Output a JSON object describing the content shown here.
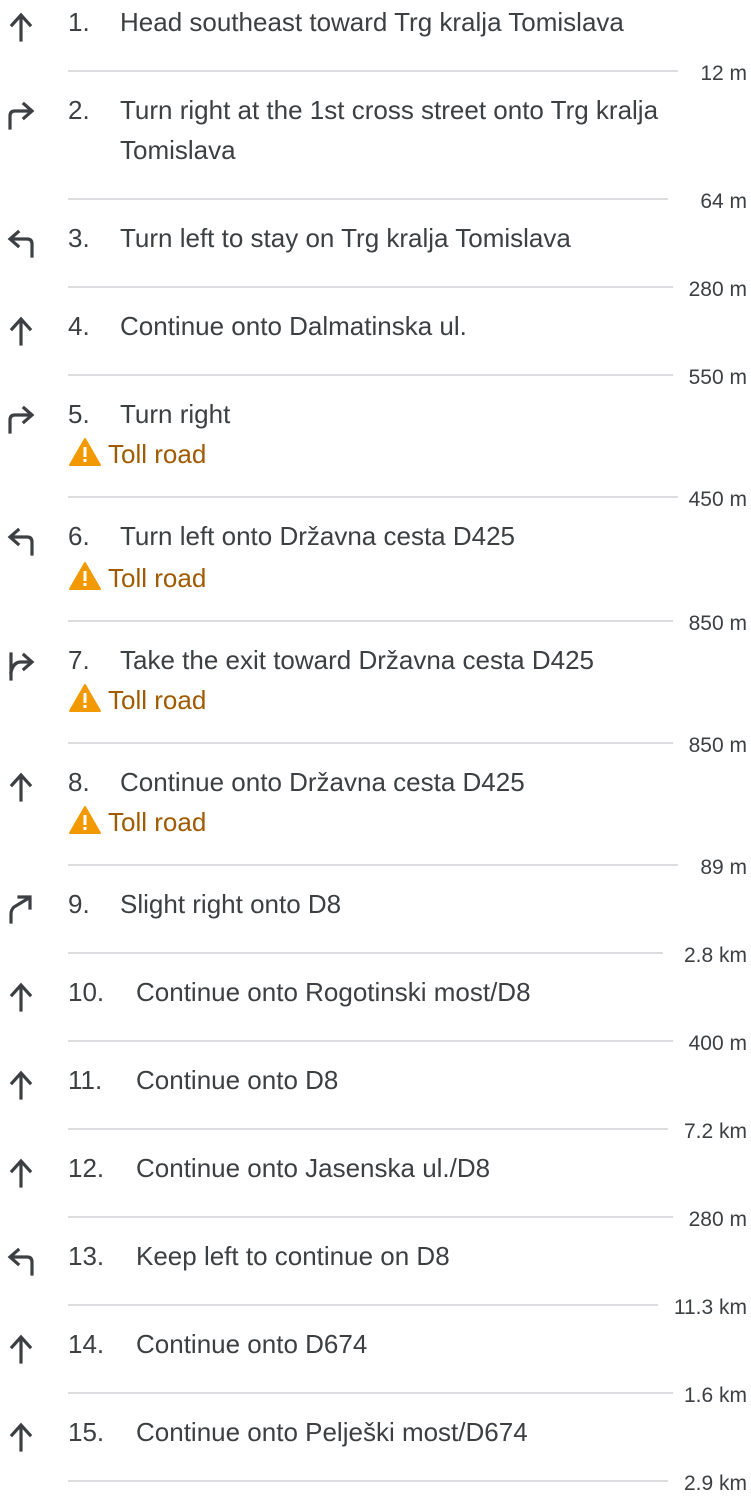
{
  "steps": [
    {
      "number": "1.",
      "text": "Head southeast toward Trg kralja Tomislava",
      "distance": "12 m",
      "maneuver": "straight-arrow-icon"
    },
    {
      "number": "2.",
      "text": "Turn right at the 1st cross street onto Trg kralja Tomislava",
      "distance": "64 m",
      "maneuver": "turn-right-arrow-icon"
    },
    {
      "number": "3.",
      "text": "Turn left to stay on Trg kralja Tomislava",
      "distance": "280 m",
      "maneuver": "turn-left-arrow-icon"
    },
    {
      "number": "4.",
      "text": "Continue onto Dalmatinska ul.",
      "distance": "550 m",
      "maneuver": "straight-arrow-icon"
    },
    {
      "number": "5.",
      "text": "Turn right",
      "note": "Toll road",
      "distance": "450 m",
      "maneuver": "turn-right-arrow-icon"
    },
    {
      "number": "6.",
      "text": "Turn left onto Državna cesta D425",
      "note": "Toll road",
      "distance": "850 m",
      "maneuver": "turn-left-arrow-icon"
    },
    {
      "number": "7.",
      "text": "Take the exit toward Državna cesta D425",
      "note": "Toll road",
      "distance": "850 m",
      "maneuver": "exit-right-arrow-icon"
    },
    {
      "number": "8.",
      "text": "Continue onto Državna cesta D425",
      "note": "Toll road",
      "distance": "89 m",
      "maneuver": "straight-arrow-icon"
    },
    {
      "number": "9.",
      "text": "Slight right onto D8",
      "distance": "2.8 km",
      "maneuver": "slight-right-arrow-icon"
    },
    {
      "number": "10.",
      "text": "Continue onto Rogotinski most/D8",
      "distance": "400 m",
      "maneuver": "straight-arrow-icon"
    },
    {
      "number": "11.",
      "text": "Continue onto D8",
      "distance": "7.2 km",
      "maneuver": "straight-arrow-icon"
    },
    {
      "number": "12.",
      "text": "Continue onto Jasenska ul./D8",
      "distance": "280 m",
      "maneuver": "straight-arrow-icon"
    },
    {
      "number": "13.",
      "text": "Keep left to continue on D8",
      "distance": "11.3 km",
      "maneuver": "keep-left-arrow-icon"
    },
    {
      "number": "14.",
      "text": "Continue onto D674",
      "distance": "1.6 km",
      "maneuver": "straight-arrow-icon"
    },
    {
      "number": "15.",
      "text": "Continue onto Pelješki most/D674",
      "distance": "2.9 km",
      "maneuver": "straight-arrow-icon"
    }
  ],
  "colors": {
    "text": "#3c4043",
    "toll_text": "#a05a00",
    "warning_icon": "#f29900",
    "separator": "#dadce0",
    "icon": "#3c4043"
  }
}
